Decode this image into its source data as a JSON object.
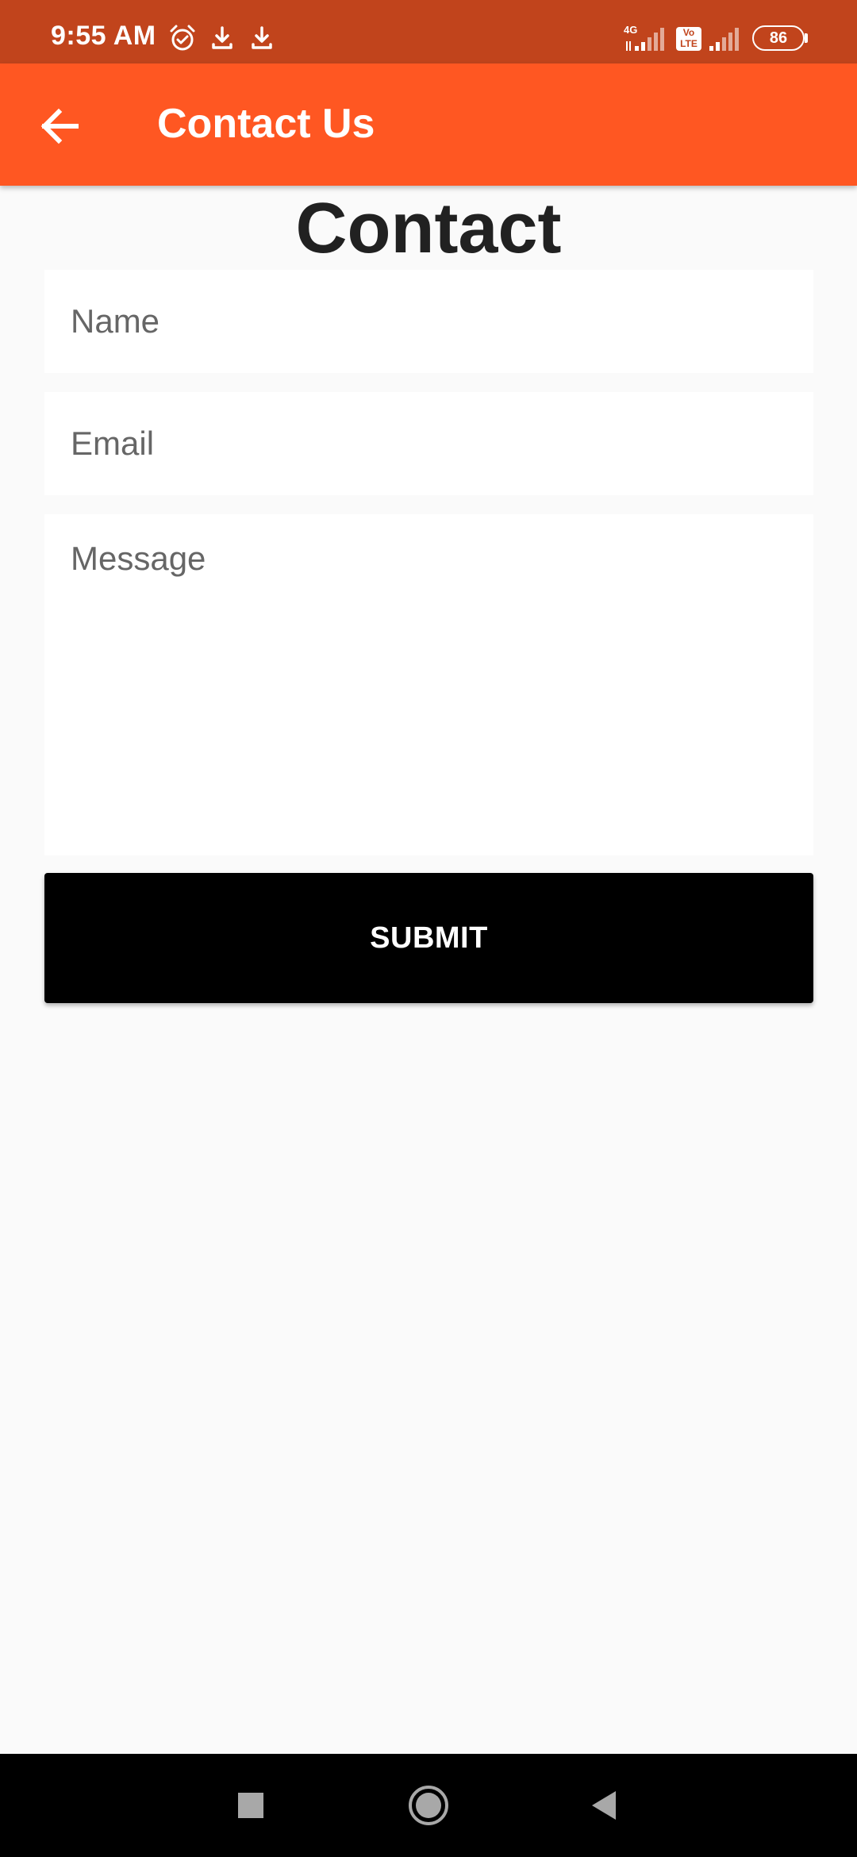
{
  "status_bar": {
    "time": "9:55 AM",
    "icons": [
      "alarm-icon",
      "download-icon",
      "download-icon"
    ],
    "network_label": "4G",
    "volte_label": "Vo LTE",
    "battery": "86"
  },
  "app_bar": {
    "back_icon": "arrow-back-icon",
    "title": "Contact Us"
  },
  "page": {
    "heading": "Contact"
  },
  "form": {
    "name_placeholder": "Name",
    "email_placeholder": "Email",
    "message_placeholder": "Message",
    "submit_label": "SUBMIT"
  },
  "nav_bar": {
    "buttons": [
      "recents-square-icon",
      "home-circle-icon",
      "back-triangle-icon"
    ]
  },
  "colors": {
    "status_bar": "#c1441c",
    "app_bar": "#ff5722",
    "background": "#fafafa",
    "button": "#000000"
  }
}
